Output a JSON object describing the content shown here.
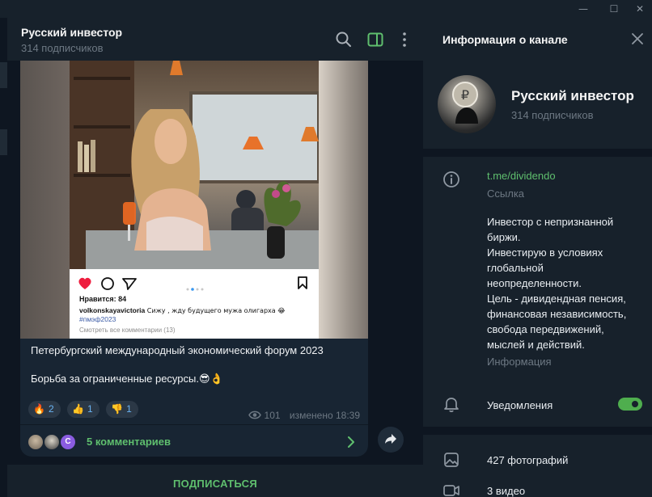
{
  "window": {
    "minimize": "—",
    "maximize": "☐",
    "close": "✕"
  },
  "chat": {
    "title": "Русский инвестор",
    "subscribers": "314 подписчиков"
  },
  "post": {
    "insta": {
      "likes": "Нравится: 84",
      "caption_user": "volkonskayavictoria",
      "caption_text": " Сижу , жду будущего мужа олигарха 😂",
      "hashtag": "#пмэф2023",
      "view_comments": "Смотреть все комментарии (13)"
    },
    "text_line1": "Петербургский международный экономический форум 2023",
    "text_line2": "Борьба за ограниченные ресурсы.😎👌",
    "reactions": [
      {
        "emoji": "🔥",
        "count": "2"
      },
      {
        "emoji": "👍",
        "count": "1"
      },
      {
        "emoji": "👎",
        "count": "1"
      }
    ],
    "views": "101",
    "edited": "изменено 18:39",
    "comments_label": "5 комментариев",
    "commenter_initial": "C"
  },
  "subscribe_label": "ПОДПИСАТЬСЯ",
  "info_panel": {
    "title": "Информация о канале",
    "name": "Русский инвестор",
    "subscribers": "314 подписчиков",
    "link": "t.me/dividendo",
    "link_label": "Ссылка",
    "about_lines": [
      "Инвестор с непризнанной",
      "биржи.",
      "Инвестирую в условиях",
      "глобальной",
      "неопределенности.",
      "Цель - дивидендная пенсия,",
      "финансовая независимость,",
      "свобода передвижений,",
      "мыслей и действий."
    ],
    "about_label": "Информация",
    "notifications_label": "Уведомления",
    "notifications_on": true,
    "photos": "427 фотографий",
    "videos": "3 видео"
  },
  "colors": {
    "accent_green": "#5fbf6e",
    "panel_bg": "#17212b",
    "chat_bg": "#0e1621",
    "bubble_bg": "#182533"
  }
}
